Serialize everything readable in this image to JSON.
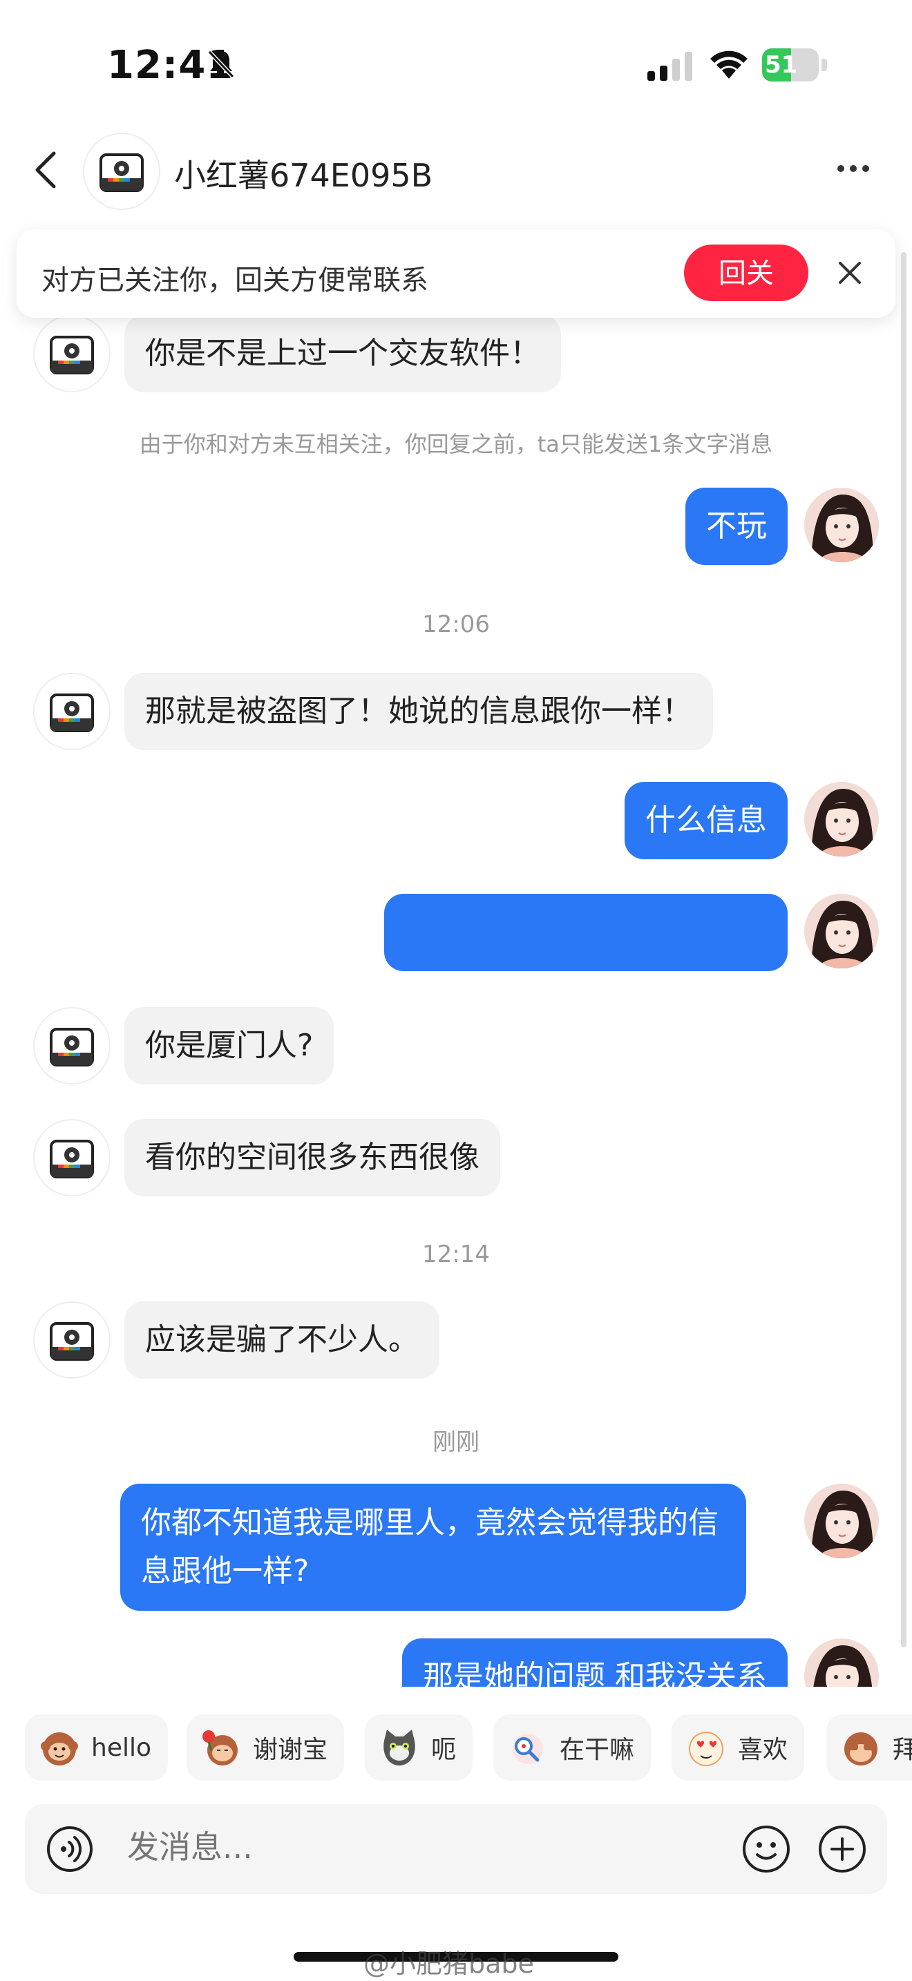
{
  "status_bar": {
    "time": "12:41",
    "battery": "51",
    "battery_level_percent": 51
  },
  "header": {
    "title": "小红薯674E095B"
  },
  "banner": {
    "text": "对方已关注你，回关方便常联系",
    "follow_label": "回关"
  },
  "messages": [
    {
      "side": "left",
      "text": "你是不是上过一个交友软件！"
    },
    {
      "side": "notice",
      "text": "由于你和对方未互相关注，你回复之前，ta只能发送1条文字消息"
    },
    {
      "side": "right",
      "text": "不玩"
    },
    {
      "side": "time",
      "text": "12:06"
    },
    {
      "side": "left",
      "text": "那就是被盗图了！她说的信息跟你一样！"
    },
    {
      "side": "right",
      "text": "什么信息"
    },
    {
      "side": "right",
      "text": ""
    },
    {
      "side": "left",
      "text": "你是厦门人?"
    },
    {
      "side": "left",
      "text": "看你的空间很多东西很像"
    },
    {
      "side": "time",
      "text": "12:14"
    },
    {
      "side": "left",
      "text": "应该是骗了不少人。"
    },
    {
      "side": "time",
      "text": "刚刚"
    },
    {
      "side": "right",
      "text": "你都不知道我是哪里人，竟然会觉得我的信息跟他一样?"
    },
    {
      "side": "right",
      "text": "那是她的问题 和我没关系"
    }
  ],
  "stickers": [
    {
      "label": "hello",
      "icon": "monkey-icon"
    },
    {
      "label": "谢谢宝",
      "icon": "monkey-rose-icon"
    },
    {
      "label": "呃",
      "icon": "cat-icon"
    },
    {
      "label": "在干嘛",
      "icon": "magnifier-icon"
    },
    {
      "label": "喜欢",
      "icon": "heart-eyes-icon"
    },
    {
      "label": "拜",
      "icon": "monkey-bye-icon"
    }
  ],
  "input": {
    "placeholder": "发消息..."
  },
  "watermark": "@小肥猪babe",
  "colors": {
    "accent_blue": "#2a78f5",
    "follow_red": "#ff2442",
    "battery_green": "#34c759"
  }
}
